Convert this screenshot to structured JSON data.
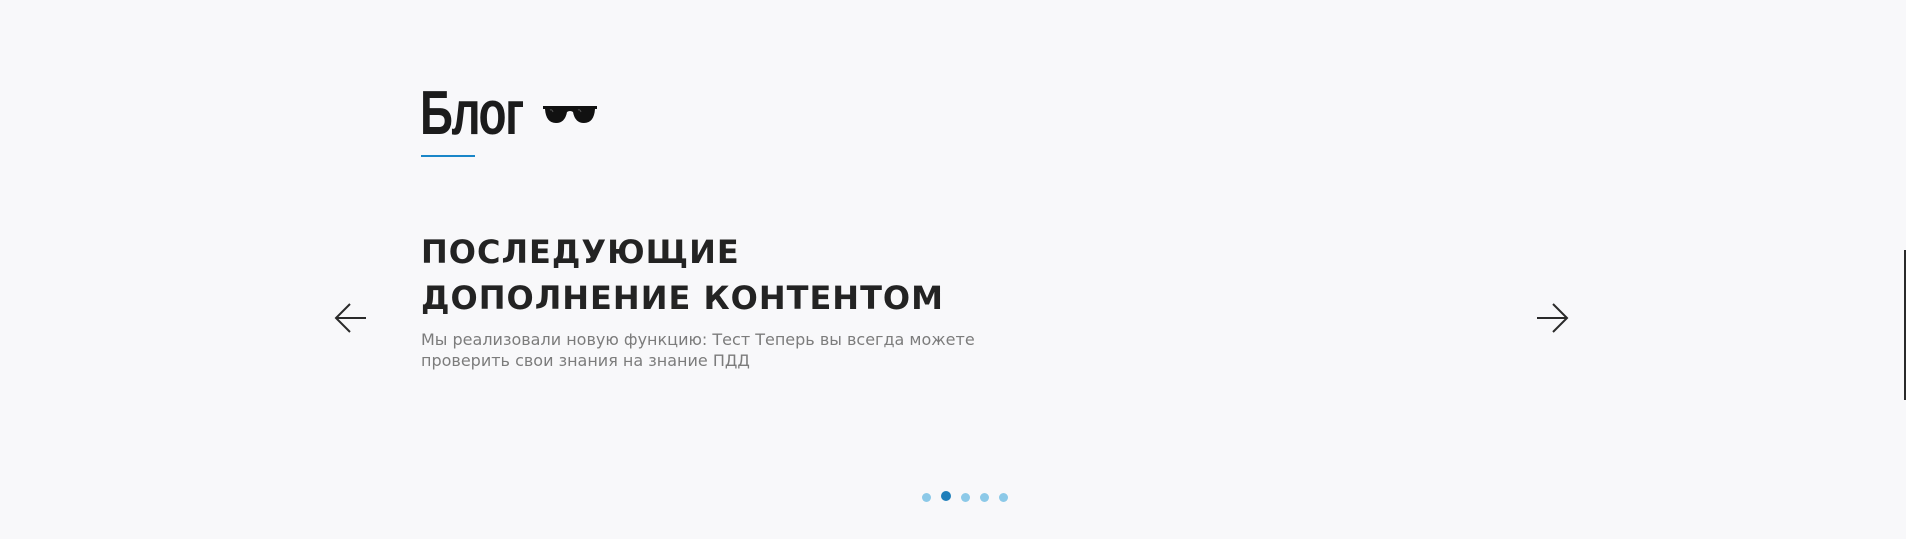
{
  "section": {
    "title": "Блог",
    "icon": "sunglasses-icon"
  },
  "slider": {
    "current_slide": 2,
    "total_slides": 5,
    "slide": {
      "heading": "ПОСЛЕДУЮЩИЕ ДОПОЛНЕНИЕ КОНТЕНТОМ",
      "text": "Мы реализовали новую функцию: Тест Теперь вы всегда можете проверить свои знания на знание ПДД"
    },
    "prev_icon": "arrow-left-icon",
    "next_icon": "arrow-right-icon"
  },
  "colors": {
    "background": "#f8f8fa",
    "accent": "#1a86c8",
    "dot_inactive": "#8cc9e8",
    "dot_active": "#1f7fba"
  }
}
